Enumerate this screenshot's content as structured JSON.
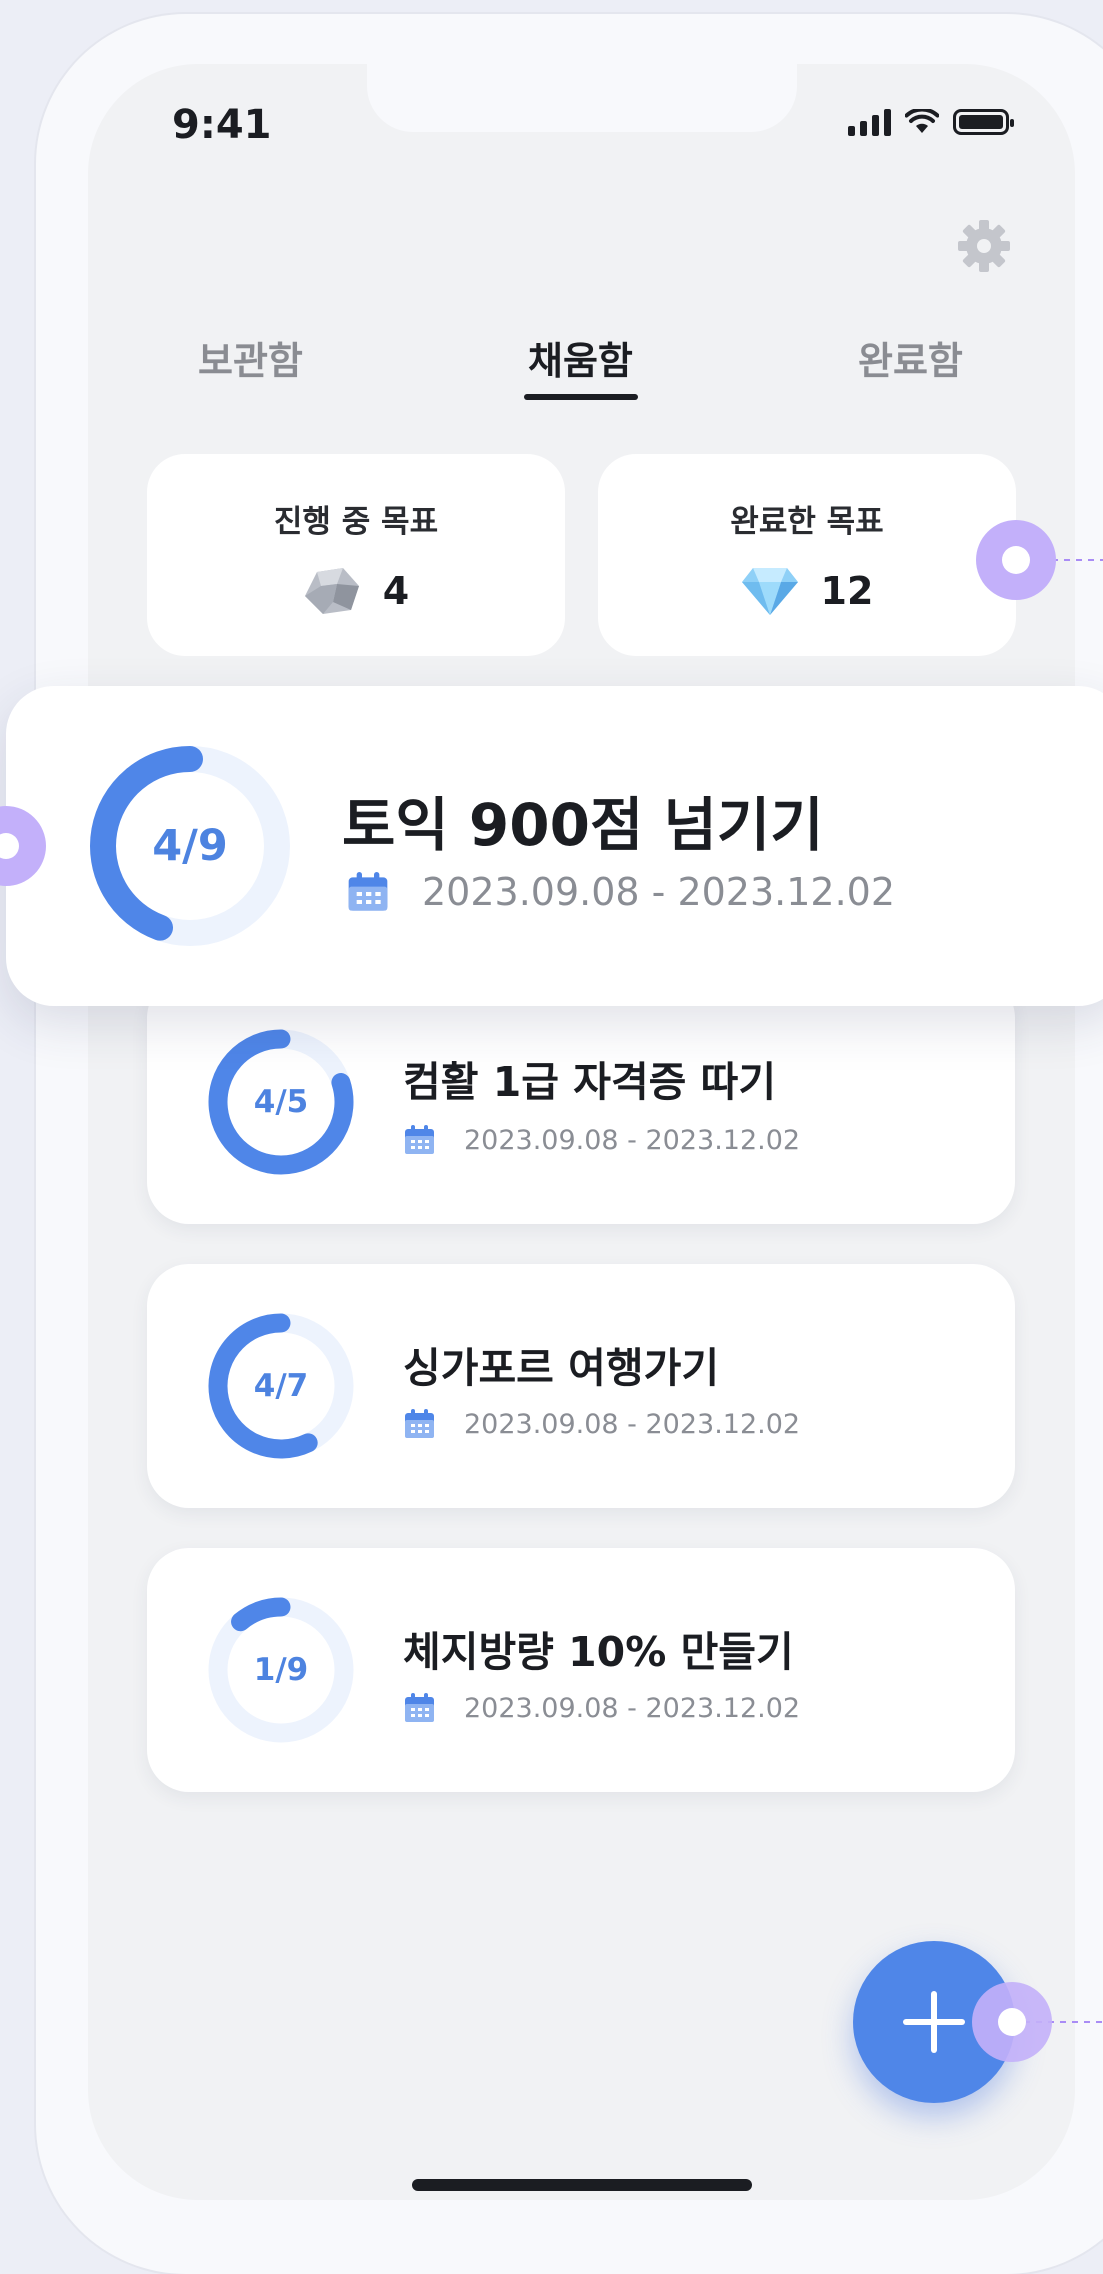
{
  "status_bar": {
    "time": "9:41"
  },
  "tabs": [
    {
      "label": "보관함",
      "active": false
    },
    {
      "label": "채움함",
      "active": true
    },
    {
      "label": "완료함",
      "active": false
    }
  ],
  "stats": {
    "in_progress": {
      "label": "진행 중 목표",
      "value": "4",
      "icon": "rock-gem-icon"
    },
    "completed": {
      "label": "완료한 목표",
      "value": "12",
      "icon": "diamond-icon"
    }
  },
  "goals": [
    {
      "title": "토익 900점 넘기기",
      "progress_label": "4/9",
      "progress": 0.444,
      "date": "2023.09.08 - 2023.12.02",
      "featured": true
    },
    {
      "title": "컴활 1급 자격증 따기",
      "progress_label": "4/5",
      "progress": 0.8,
      "date": "2023.09.08 - 2023.12.02"
    },
    {
      "title": "싱가포르 여행가기",
      "progress_label": "4/7",
      "progress": 0.571,
      "date": "2023.09.08 - 2023.12.02"
    },
    {
      "title": "체지방량 10% 만들기",
      "progress_label": "1/9",
      "progress": 0.111,
      "date": "2023.09.08 - 2023.12.02"
    }
  ],
  "colors": {
    "accent": "#4f86e8",
    "ring_track": "#edf3fd",
    "connector": "#a98cf5"
  }
}
